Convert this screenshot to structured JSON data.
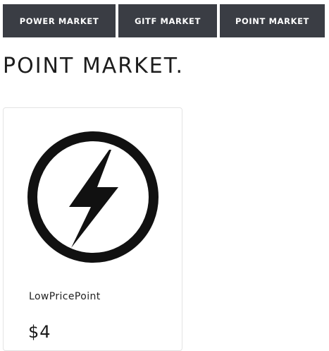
{
  "nav": {
    "items": [
      {
        "label": "POWER MARKET"
      },
      {
        "label": "GITF MARKET"
      },
      {
        "label": "POINT MARKET"
      }
    ]
  },
  "page": {
    "title": "POINT MARKET."
  },
  "products": [
    {
      "name": "LowPricePoint",
      "price": "$4",
      "icon": "lightning-bolt-icon"
    }
  ],
  "colors": {
    "nav_background": "#3a3d44",
    "nav_text": "#ffffff",
    "title_text": "#1d1d1d",
    "card_border": "#e3e3e3"
  }
}
